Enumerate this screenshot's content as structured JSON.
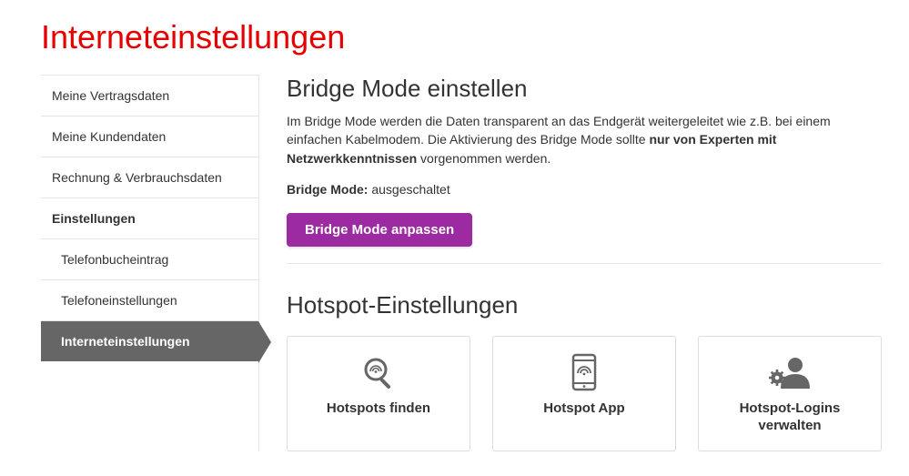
{
  "page_title": "Interneteinstellungen",
  "sidebar": {
    "items": [
      {
        "label": "Meine Vertragsdaten"
      },
      {
        "label": "Meine Kundendaten"
      },
      {
        "label": "Rechnung & Verbrauchsdaten"
      },
      {
        "label": "Einstellungen"
      },
      {
        "label": "Telefonbucheintrag"
      },
      {
        "label": "Telefoneinstellungen"
      },
      {
        "label": "Interneteinstellungen"
      }
    ]
  },
  "bridge": {
    "title": "Bridge Mode einstellen",
    "desc_part1": "Im Bridge Mode werden die Daten transparent an das Endgerät weitergeleitet wie z.B. bei einem einfachen Kabelmodem. Die Aktivierung des Bridge Mode sollte ",
    "desc_bold": "nur von Experten mit Netzwerkkenntnissen",
    "desc_part2": " vorgenommen werden.",
    "status_label": "Bridge Mode:",
    "status_value": "ausgeschaltet",
    "button": "Bridge Mode anpassen"
  },
  "hotspot": {
    "title": "Hotspot-Einstellungen",
    "cards": [
      {
        "label": "Hotspots finden",
        "icon": "search-wifi-icon"
      },
      {
        "label": "Hotspot App",
        "icon": "phone-wifi-icon"
      },
      {
        "label": "Hotspot-Logins verwalten",
        "icon": "user-gear-icon"
      }
    ]
  }
}
